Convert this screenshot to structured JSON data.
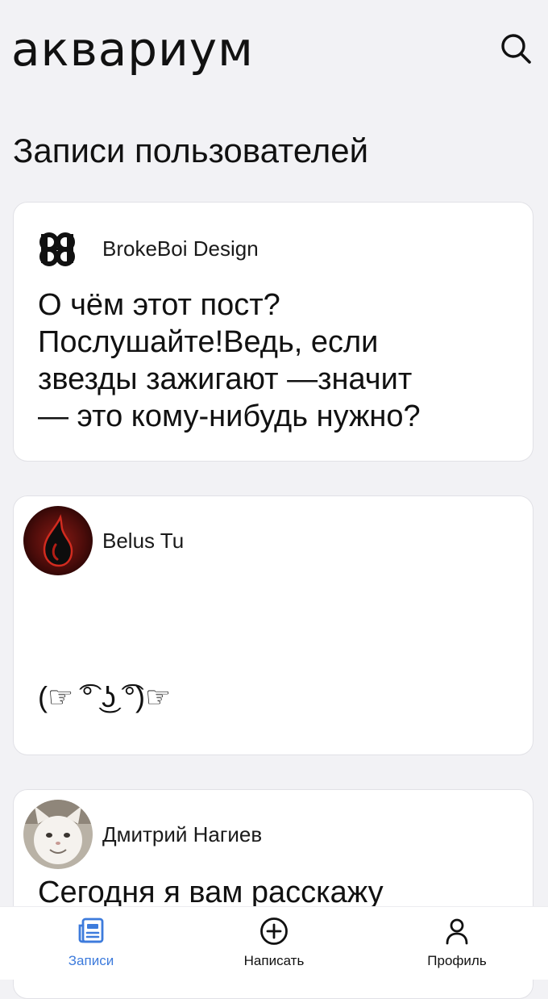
{
  "app": {
    "logo": "аквариум"
  },
  "page": {
    "title": "Записи пользователей"
  },
  "posts": [
    {
      "author": "BrokeBoi Design",
      "text": "О чём этот пост?\nПослушайте!Ведь, если\nзвезды зажигают —значит\n— это кому-нибудь нужно?"
    },
    {
      "author": "Belus Tu",
      "text": "(☞ ͡° ͜ʖ ͡°)☞"
    },
    {
      "author": "Дмитрий Нагиев",
      "text": "Сегодня я вам расскажу"
    }
  ],
  "nav": {
    "items": [
      {
        "label": "Записи",
        "icon": "news-icon",
        "active": true
      },
      {
        "label": "Написать",
        "icon": "plus-circle-icon",
        "active": false
      },
      {
        "label": "Профиль",
        "icon": "user-icon",
        "active": false
      }
    ]
  },
  "colors": {
    "background": "#f2f2f5",
    "card": "#ffffff",
    "accent": "#3d7bdc"
  }
}
